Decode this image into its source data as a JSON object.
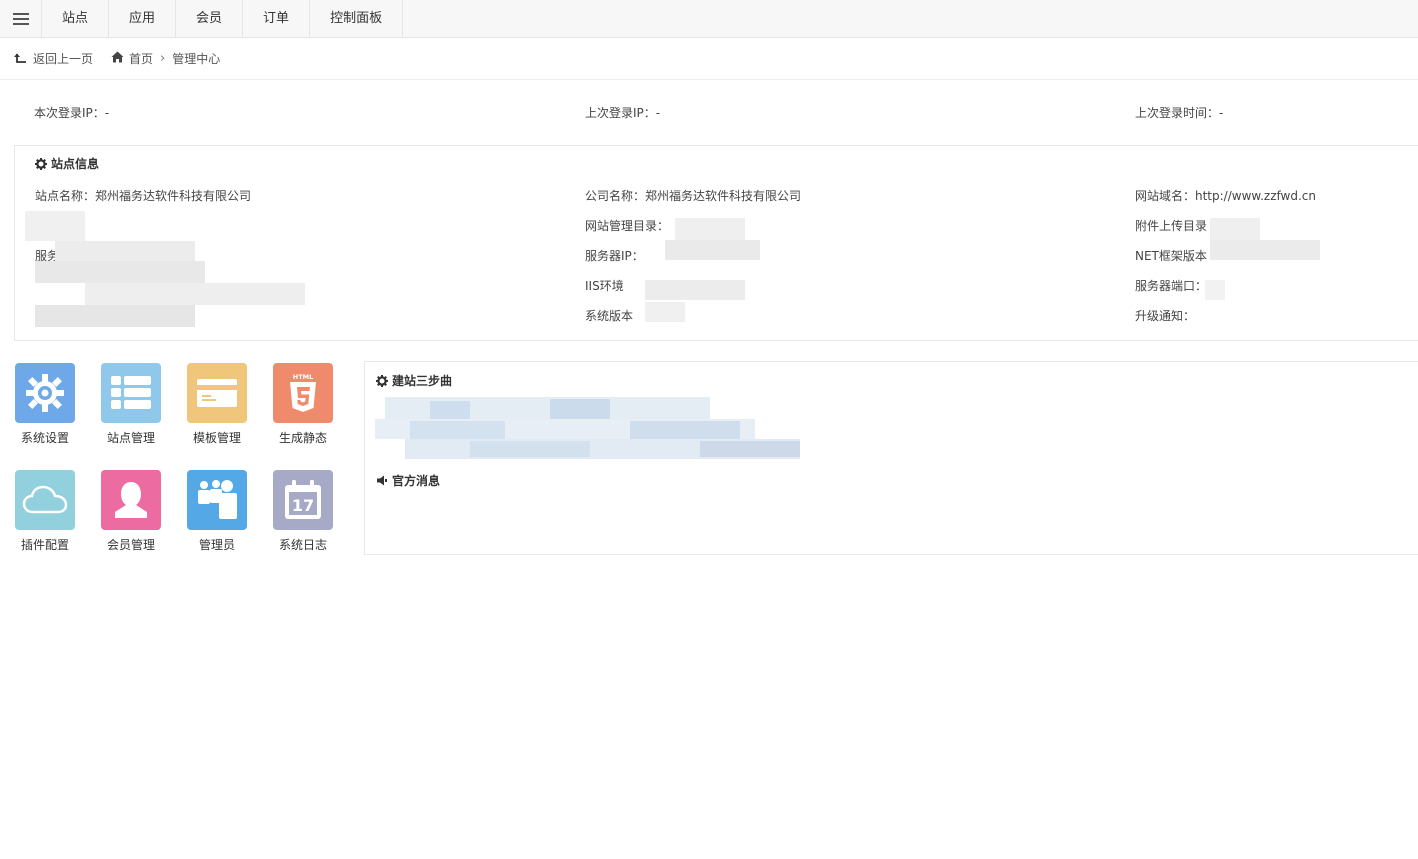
{
  "nav": {
    "tabs": [
      "站点",
      "应用",
      "会员",
      "订单",
      "控制面板"
    ]
  },
  "breadcrumb": {
    "back": "返回上一页",
    "home": "首页",
    "current": "管理中心"
  },
  "login": {
    "this_ip": "本次登录IP：-",
    "last_ip": "上次登录IP：-",
    "last_time": "上次登录时间：-"
  },
  "site_info": {
    "title": "站点信息",
    "site_name": "站点名称：郑州福务达软件科技有限公司",
    "company_name": "公司名称：郑州福务达软件科技有限公司",
    "domain": "网站域名：http://www.zzfwd.cn",
    "admin_dir": "网站管理目录：",
    "upload_dir": "附件上传目录",
    "server": "服务器",
    "server_ip": "服务器IP：",
    "net_version": "NET框架版本",
    "iis": "IIS环境",
    "server_port": "服务器端口：",
    "sys_version": "系统版本",
    "upgrade": "升级通知："
  },
  "apps": [
    {
      "label": "系统设置",
      "icon": "gear-icon",
      "color": "#6fa8e8"
    },
    {
      "label": "站点管理",
      "icon": "list-icon",
      "color": "#8fc8ea"
    },
    {
      "label": "模板管理",
      "icon": "card-icon",
      "color": "#f0c67a"
    },
    {
      "label": "生成静态",
      "icon": "html5-icon",
      "color": "#ef8a6d"
    },
    {
      "label": "插件配置",
      "icon": "cloud-icon",
      "color": "#92d0de"
    },
    {
      "label": "会员管理",
      "icon": "user-icon",
      "color": "#ec6ba1"
    },
    {
      "label": "管理员",
      "icon": "users-icon",
      "color": "#53a8e5"
    },
    {
      "label": "系统日志",
      "icon": "calendar-icon",
      "color": "#a7aac6"
    }
  ],
  "steps": {
    "title": "建站三步曲"
  },
  "news": {
    "title": "官方消息"
  }
}
